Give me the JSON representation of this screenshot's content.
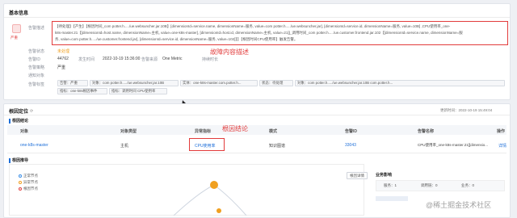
{
  "basic": {
    "title": "基本信息",
    "level_badge": "严重",
    "desc_label": "告警描述",
    "desc_lines": [
      "【待处理】【产生】【根因时间_com potter.h...../ue.websuncher.jar.10B】[dimensionId=service.name, dimensionName=服务, value=com potter.h...../ue.websuncher.jar], [dimensionId=service.id, dimensionName=服务, value=10B] ,CPU使用率_one-",
      "k8s-master.21【[dimensionId=host.name, dimensionName=主机, value=one-k8s-master], [dimensionId=host.id, dimensionName=主机, value=21]]_调用时间_com potter.h...../ue.customer.frontend.jar.102【[dimensionId=service.name, dimensionName=服",
      "务, value=com potter.h...../ue.customer.frontend.jar], [dimensionId=service.id, dimensionName=服务, value=102]】】【根因时间CPU使用率】触发告警。"
    ],
    "fault_note": "故障内容描述",
    "rows": [
      {
        "label": "告警状态",
        "value": "未处理"
      },
      {
        "label": "告警ID",
        "value": "44762"
      },
      {
        "label": "告警策略",
        "value": "严重"
      }
    ],
    "time_label": "发生时间",
    "time_value": "2022-10-19 15:36:00",
    "dur_label": "持续时长",
    "src_label": "告警来源",
    "src_value": "One Metric",
    "extra_labels": [
      "通知对象",
      "告警标签"
    ],
    "tags": [
      "告警：严重",
      "对象：com potter.h...../ue.websuncher.jar.10B",
      "实体：one-k8s-master.com.potter.h...",
      "状态：待处理",
      "对象：com potter.h...../ue.websuncher.jar.10B com.potter.h..."
    ],
    "tags2": [
      "指标：one-k8s根因事件",
      "指标：调用时间 CPU使用率"
    ]
  },
  "root": {
    "title": "根因定位",
    "update_label": "更新时间：2022-10-19 15:49:04",
    "sub_title": "根因结论",
    "conclusion_note": "根因结论",
    "headers": [
      "对象",
      "对象类型",
      "异常指标",
      "模式",
      "告警ID",
      "告警名称",
      "操作"
    ],
    "row": {
      "object": "one-k8s-master",
      "type": "主机",
      "metric": "CPU使用率",
      "mode": "知识图谱",
      "alert_id": "33043",
      "alert_name": "CPU使用率_one-k8s-master.21[[dimensio...",
      "op": "详情"
    },
    "graph_title": "根因推导",
    "legend": [
      {
        "label": "正常节点",
        "color": "#3a8ee6"
      },
      {
        "label": "异常节点",
        "color": "#f0a020"
      },
      {
        "label": "根因节点",
        "color": "#e04040"
      }
    ],
    "graph_btn": "根因详情",
    "impact_title": "业务影响",
    "stats": [
      "服务：1",
      "调用链：0",
      "业务：0"
    ],
    "watermark": "@稀土掘金技术社区"
  }
}
